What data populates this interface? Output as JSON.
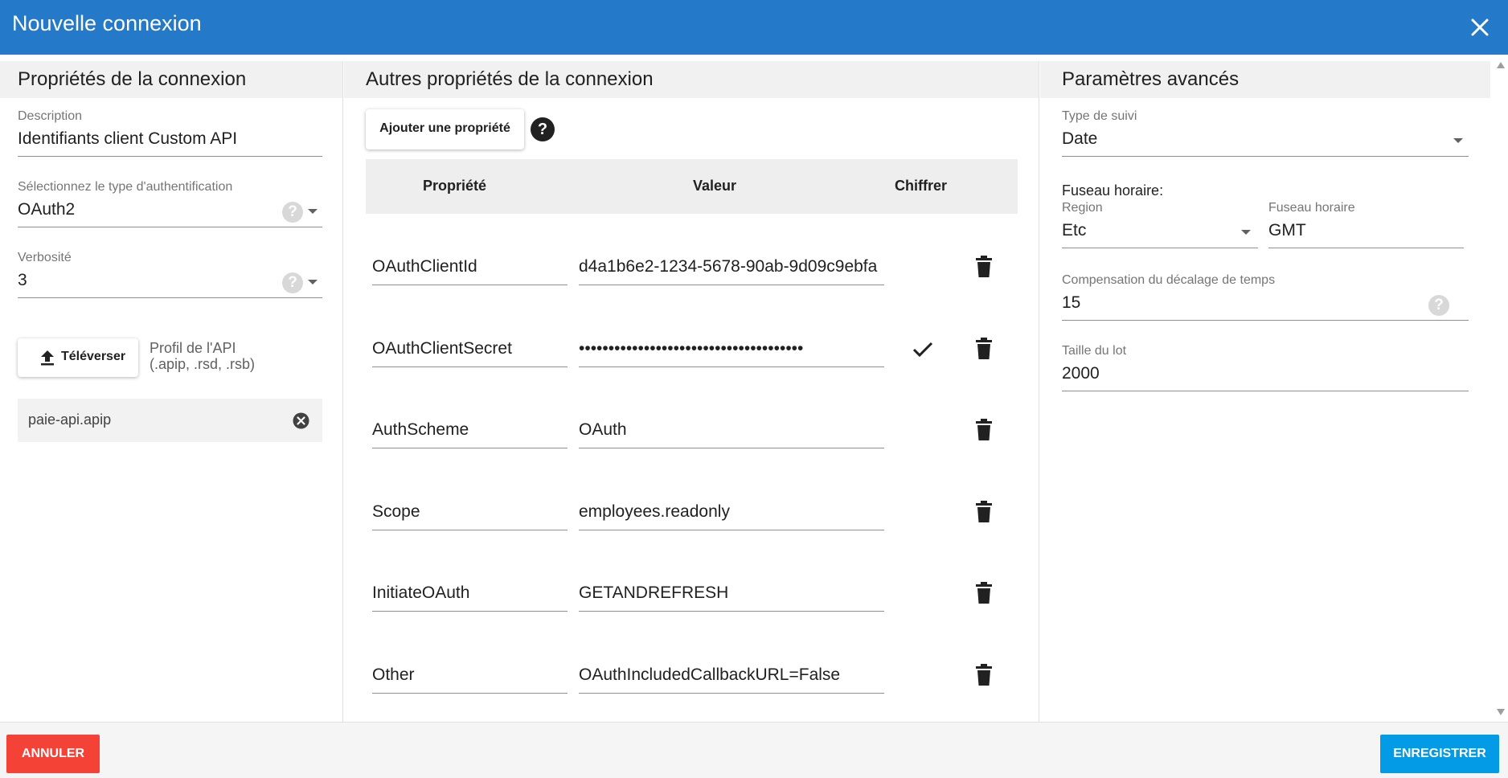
{
  "dialog": {
    "title": "Nouvelle connexion"
  },
  "connection_properties": {
    "heading": "Propriétés de la connexion",
    "description": {
      "label": "Description",
      "value": "Identifiants client Custom API"
    },
    "auth_type": {
      "label": "Sélectionnez le type d'authentification",
      "value": "OAuth2"
    },
    "verbosity": {
      "label": "Verbosité",
      "value": "3"
    },
    "upload": {
      "label": "Téléverser",
      "hint_line1": "Profil de l'API",
      "hint_line2": "(.apip, .rsd, .rsb)"
    },
    "file": {
      "name": "paie-api.apip"
    }
  },
  "other_properties": {
    "heading": "Autres propriétés de la connexion",
    "add_label": "Ajouter une propriété",
    "help_glyph": "?",
    "columns": {
      "property": "Propriété",
      "value": "Valeur",
      "encrypt": "Chiffrer"
    },
    "rows": [
      {
        "property": "OAuthClientId",
        "value": "d4a1b6e2-1234-5678-90ab-9d09c9ebfa",
        "encrypted": false
      },
      {
        "property": "OAuthClientSecret",
        "value": "••••••••••••••••••••••••••••••••••••••",
        "encrypted": true
      },
      {
        "property": "AuthScheme",
        "value": "OAuth",
        "encrypted": false
      },
      {
        "property": "Scope",
        "value": "employees.readonly",
        "encrypted": false
      },
      {
        "property": "InitiateOAuth",
        "value": "GETANDREFRESH",
        "encrypted": false
      },
      {
        "property": "Other",
        "value": "OAuthIncludedCallbackURL=False",
        "encrypted": false
      }
    ]
  },
  "advanced": {
    "heading": "Paramètres avancés",
    "tracking_type": {
      "label": "Type de suivi",
      "value": "Date"
    },
    "timezone_heading": "Fuseau horaire:",
    "region": {
      "label": "Region",
      "value": "Etc"
    },
    "timezone": {
      "label": "Fuseau horaire",
      "value": "GMT"
    },
    "time_offset": {
      "label": "Compensation du décalage de temps",
      "value": "15"
    },
    "batch_size": {
      "label": "Taille du lot",
      "value": "2000"
    }
  },
  "footer": {
    "cancel_label": "ANNULER",
    "save_label": "ENREGISTRER"
  },
  "colors": {
    "titlebar": "#2479c8",
    "cancel": "#f44336",
    "save": "#039be5"
  },
  "icons": {
    "close": "close-icon",
    "upload": "upload-icon",
    "clear": "clear-circle-icon",
    "delete": "trash-icon",
    "check": "check-icon",
    "help": "help-icon"
  }
}
